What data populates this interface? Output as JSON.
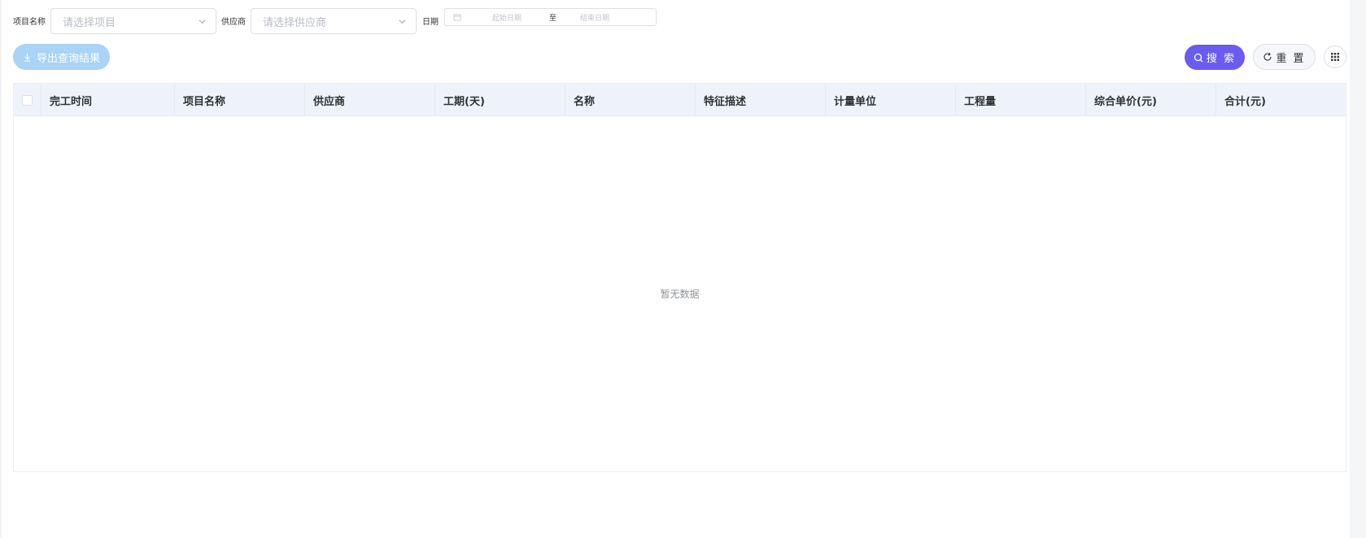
{
  "filters": {
    "project_label": "项目名称",
    "project_placeholder": "请选择项目",
    "supplier_label": "供应商",
    "supplier_placeholder": "请选择供应商",
    "date_label": "日期",
    "date_start_placeholder": "起始日期",
    "date_separator": "至",
    "date_end_placeholder": "结束日期"
  },
  "toolbar": {
    "export_label": "导出查询结果",
    "search_label": "搜 索",
    "reset_label": "重 置"
  },
  "table": {
    "columns": [
      "完工时间",
      "项目名称",
      "供应商",
      "工期(天)",
      "名称",
      "特征描述",
      "计量单位",
      "工程量",
      "综合单价(元)",
      "合计(元)"
    ],
    "empty_text": "暂无数据"
  },
  "colors": {
    "primary": "#6a5cf0",
    "export_disabled": "#a9d3f7",
    "header_bg": "#eef3fb"
  }
}
